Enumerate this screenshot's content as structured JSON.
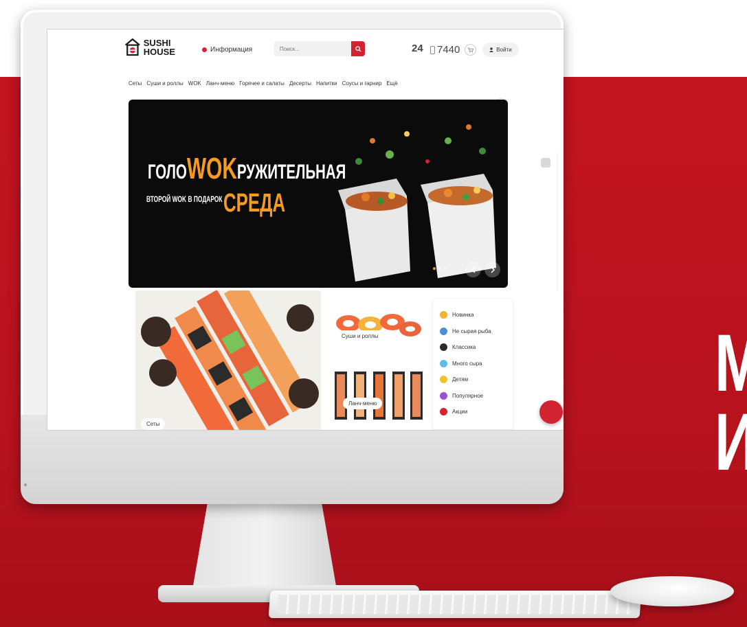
{
  "brand": {
    "name_line1": "SUSHI",
    "name_line2": "HOUSE",
    "accent_color": "#d22331",
    "highlight_color": "#f59b22"
  },
  "header": {
    "info_label": "Информация",
    "search_placeholder": "Поиск...",
    "hours": "24",
    "phone": "7440",
    "login_label": "Войти"
  },
  "nav": {
    "items": [
      "Сеты",
      "Суши и роллы",
      "WOK",
      "Ланч-меню",
      "Горячее и салаты",
      "Десерты",
      "Напитки",
      "Соусы и гарнир",
      "Ещё"
    ]
  },
  "banner": {
    "title_part1": "ГОЛО",
    "title_accent": "WOK",
    "title_part2": "РУЖИТЕЛЬНАЯ",
    "subtitle": "ВТОРОЙ WOK В ПОДАРОК",
    "day": "СРЕДА",
    "slides": 3,
    "active_slide": 1
  },
  "categories": {
    "sets_label": "Сеты",
    "rolls_label": "Суши и роллы",
    "lunch_label": "Ланч-меню"
  },
  "filters": [
    {
      "label": "Новинка",
      "color": "#f2b22b"
    },
    {
      "label": "Не сырая рыба",
      "color": "#4a8fd1"
    },
    {
      "label": "Классика",
      "color": "#2b2b2b"
    },
    {
      "label": "Много сыра",
      "color": "#5fbde3"
    },
    {
      "label": "Детям",
      "color": "#f2c12b"
    },
    {
      "label": "Популярное",
      "color": "#9b4fd1"
    },
    {
      "label": "Акции",
      "color": "#d22331"
    }
  ],
  "side_text": {
    "line1": "М",
    "line2": "И"
  }
}
